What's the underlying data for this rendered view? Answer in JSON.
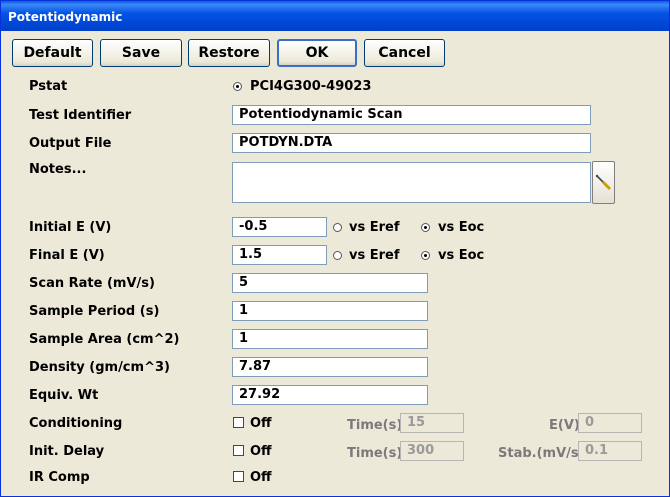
{
  "window": {
    "title": "Potentiodynamic"
  },
  "toolbar": {
    "default": "Default",
    "save": "Save",
    "restore": "Restore",
    "ok": "OK",
    "cancel": "Cancel"
  },
  "pstat": {
    "label": "Pstat",
    "value": "PCI4G300-49023",
    "selected": true
  },
  "fields": {
    "test_identifier": {
      "label": "Test Identifier",
      "value": "Potentiodynamic Scan"
    },
    "output_file": {
      "label": "Output File",
      "value": "POTDYN.DTA"
    },
    "notes": {
      "label": "Notes...",
      "value": ""
    },
    "initial_e": {
      "label": "Initial E (V)",
      "value": "-0.5",
      "vs_eref": "vs Eref",
      "vs_eoc": "vs Eoc",
      "selected": "vs Eoc"
    },
    "final_e": {
      "label": "Final E (V)",
      "value": "1.5",
      "vs_eref": "vs Eref",
      "vs_eoc": "vs Eoc",
      "selected": "vs Eoc"
    },
    "scan_rate": {
      "label": "Scan Rate (mV/s)",
      "value": "5"
    },
    "sample_period": {
      "label": "Sample Period (s)",
      "value": "1"
    },
    "sample_area": {
      "label": "Sample Area (cm^2)",
      "value": "1"
    },
    "density": {
      "label": "Density (gm/cm^3)",
      "value": "7.87"
    },
    "equiv_wt": {
      "label": "Equiv. Wt",
      "value": "27.92"
    }
  },
  "conditioning": {
    "label": "Conditioning",
    "check_label": "Off",
    "checked": false,
    "time_label": "Time(s)",
    "time_value": "15",
    "e_label": "E(V)",
    "e_value": "0"
  },
  "init_delay": {
    "label": "Init. Delay",
    "check_label": "Off",
    "checked": false,
    "time_label": "Time(s)",
    "time_value": "300",
    "stab_label": "Stab.(mV/s)",
    "stab_value": "0.1"
  },
  "ir_comp": {
    "label": "IR Comp",
    "check_label": "Off",
    "checked": false
  },
  "icons": {
    "notes_button": "screwdriver-icon"
  }
}
